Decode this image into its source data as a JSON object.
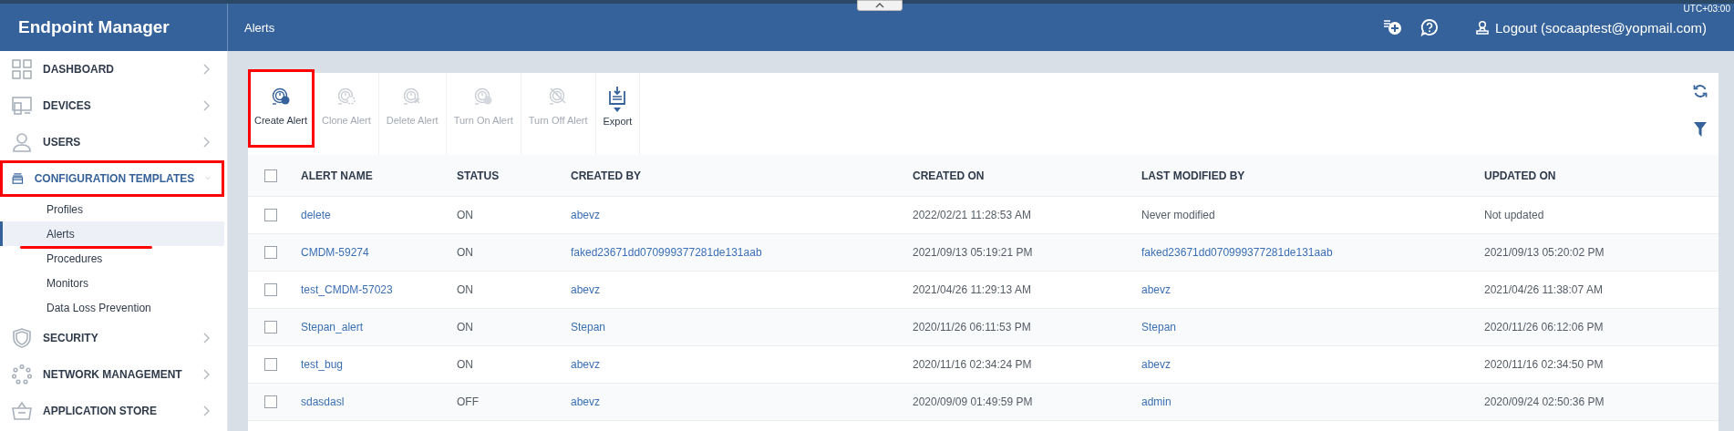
{
  "app_title": "Endpoint Manager",
  "page_title": "Alerts",
  "timezone": "UTC+03:00",
  "logout": "Logout (socaaptest@yopmail.com)",
  "sidebar": {
    "items": [
      {
        "label": "DASHBOARD",
        "kind": "grid",
        "expanded": false,
        "highlighted": false
      },
      {
        "label": "DEVICES",
        "kind": "devices",
        "expanded": false,
        "highlighted": false
      },
      {
        "label": "USERS",
        "kind": "user",
        "expanded": false,
        "highlighted": false
      },
      {
        "label": "CONFIGURATION TEMPLATES",
        "kind": "tray",
        "expanded": true,
        "highlighted": true,
        "children": [
          {
            "label": "Profiles",
            "selected": false,
            "underlined": false
          },
          {
            "label": "Alerts",
            "selected": true,
            "underlined": true
          },
          {
            "label": "Procedures",
            "selected": false,
            "underlined": false
          },
          {
            "label": "Monitors",
            "selected": false,
            "underlined": false
          },
          {
            "label": "Data Loss Prevention",
            "selected": false,
            "underlined": false
          }
        ]
      },
      {
        "label": "SECURITY",
        "kind": "shield",
        "expanded": false,
        "highlighted": false
      },
      {
        "label": "NETWORK MANAGEMENT",
        "kind": "network",
        "expanded": false,
        "highlighted": false
      },
      {
        "label": "APPLICATION STORE",
        "kind": "basket",
        "expanded": false,
        "highlighted": false
      }
    ]
  },
  "toolbar": [
    {
      "label": "Create Alert",
      "kind": "create",
      "disabled": false,
      "highlighted": true
    },
    {
      "label": "Clone Alert",
      "kind": "clone",
      "disabled": true,
      "highlighted": false
    },
    {
      "label": "Delete Alert",
      "kind": "delete",
      "disabled": true,
      "highlighted": false
    },
    {
      "label": "Turn On Alert",
      "kind": "on",
      "disabled": true,
      "highlighted": false
    },
    {
      "label": "Turn Off Alert",
      "kind": "off",
      "disabled": true,
      "highlighted": false
    },
    {
      "label": "Export",
      "kind": "export",
      "disabled": false,
      "highlighted": false
    }
  ],
  "table": {
    "header_checked": false,
    "columns": [
      "ALERT NAME",
      "STATUS",
      "CREATED BY",
      "CREATED ON",
      "LAST MODIFIED BY",
      "UPDATED ON"
    ],
    "rows": [
      {
        "checked": false,
        "name": "delete",
        "status": "ON",
        "created_by": "abevz",
        "created_on": "2022/02/21 11:28:53 AM",
        "last_modified_by": {
          "text": "Never modified",
          "link": false
        },
        "updated_on": "Not updated"
      },
      {
        "checked": false,
        "name": "CMDM-59274",
        "status": "ON",
        "created_by": "faked23671dd070999377281de131aab",
        "created_on": "2021/09/13 05:19:21 PM",
        "last_modified_by": {
          "text": "faked23671dd070999377281de131aab",
          "link": true
        },
        "updated_on": "2021/09/13 05:20:02 PM"
      },
      {
        "checked": false,
        "name": "test_CMDM-57023",
        "status": "ON",
        "created_by": "abevz",
        "created_on": "2021/04/26 11:29:13 AM",
        "last_modified_by": {
          "text": "abevz",
          "link": true
        },
        "updated_on": "2021/04/26 11:38:07 AM"
      },
      {
        "checked": false,
        "name": "Stepan_alert",
        "status": "ON",
        "created_by": "Stepan",
        "created_on": "2020/11/26 06:11:53 PM",
        "last_modified_by": {
          "text": "Stepan",
          "link": true
        },
        "updated_on": "2020/11/26 06:12:06 PM"
      },
      {
        "checked": false,
        "name": "test_bug",
        "status": "ON",
        "created_by": "abevz",
        "created_on": "2020/11/16 02:34:24 PM",
        "last_modified_by": {
          "text": "abevz",
          "link": true
        },
        "updated_on": "2020/11/16 02:34:50 PM"
      },
      {
        "checked": false,
        "name": "sdasdasl",
        "status": "OFF",
        "created_by": "abevz",
        "created_on": "2020/09/09 01:49:59 PM",
        "last_modified_by": {
          "text": "admin",
          "link": true
        },
        "updated_on": "2020/09/24 02:50:36 PM"
      }
    ]
  }
}
